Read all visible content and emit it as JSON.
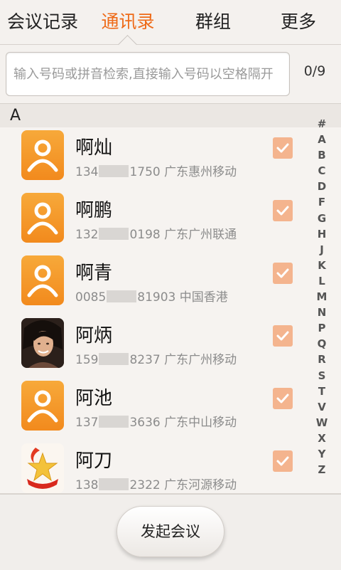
{
  "tabs": [
    {
      "label": "会议记录",
      "active": false
    },
    {
      "label": "通讯录",
      "active": true
    },
    {
      "label": "群组",
      "active": false
    },
    {
      "label": "更多",
      "active": false
    }
  ],
  "search": {
    "placeholder": "输入号码或拼音检索,直接输入号码以空格隔开",
    "value": "",
    "count": "0/9"
  },
  "section": {
    "letter": "A"
  },
  "contacts": [
    {
      "name": "啊灿",
      "phone_start": "134",
      "phone_end": "1750",
      "location": "广东惠州移动",
      "avatar": "default-avatar-icon",
      "checked": true
    },
    {
      "name": "啊鹏",
      "phone_start": "132",
      "phone_end": "0198",
      "location": "广东广州联通",
      "avatar": "default-avatar-icon",
      "checked": true
    },
    {
      "name": "啊青",
      "phone_start": "0085",
      "phone_end": "81903",
      "location": "中国香港",
      "avatar": "default-avatar-icon",
      "checked": true
    },
    {
      "name": "阿炳",
      "phone_start": "159",
      "phone_end": "8237",
      "location": "广东广州移动",
      "avatar": "photo-avatar",
      "checked": true
    },
    {
      "name": "阿池",
      "phone_start": "137",
      "phone_end": "3636",
      "location": "广东中山移动",
      "avatar": "default-avatar-icon",
      "checked": true
    },
    {
      "name": "阿刀",
      "phone_start": "138",
      "phone_end": "2322",
      "location": "广东河源移动",
      "avatar": "star-badge-avatar",
      "checked": true
    }
  ],
  "alphabet": [
    "#",
    "A",
    "B",
    "C",
    "D",
    "F",
    "G",
    "H",
    "J",
    "K",
    "L",
    "M",
    "N",
    "P",
    "Q",
    "R",
    "S",
    "T",
    "V",
    "W",
    "X",
    "Y",
    "Z"
  ],
  "bottom": {
    "start_label": "发起会议"
  },
  "colors": {
    "accent": "#ee6a17",
    "avatar_orange": "#f49a2a",
    "check": "#f4b48e"
  }
}
